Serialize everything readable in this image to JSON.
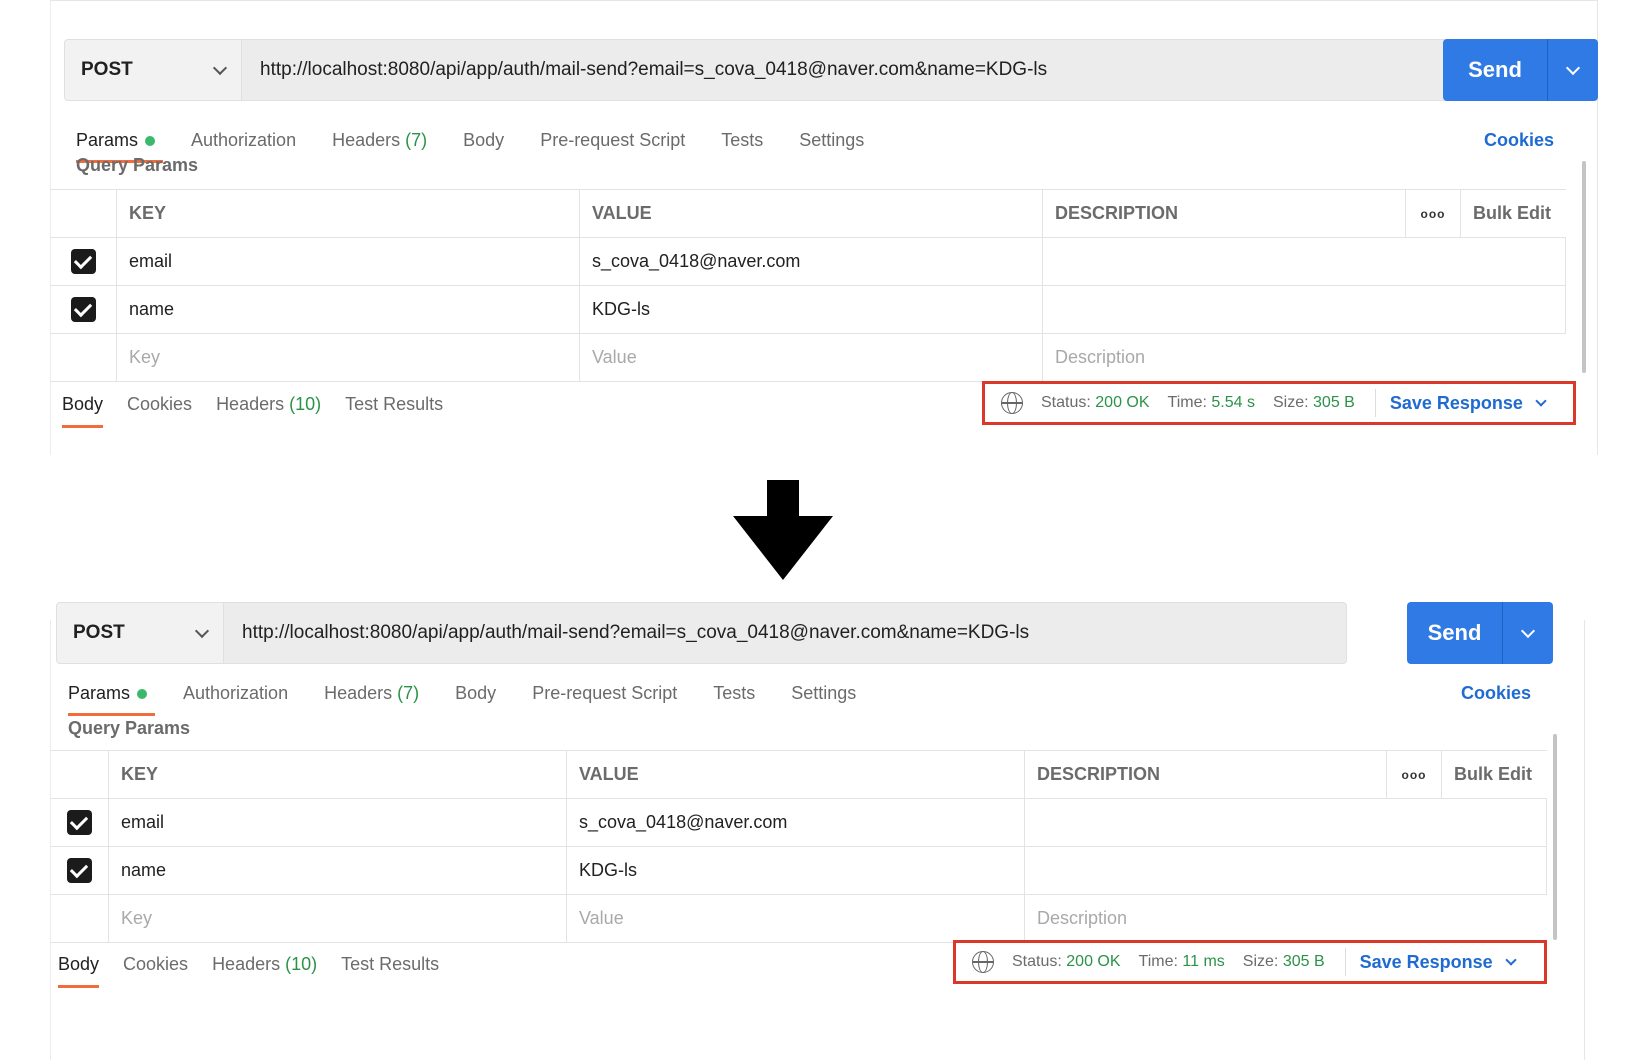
{
  "panels": {
    "top": {
      "method": "POST",
      "url": "http://localhost:8080/api/app/auth/mail-send?email=s_cova_0418@naver.com&name=KDG-ls",
      "send_label": "Send",
      "tabs": [
        "Params",
        "Authorization",
        "Headers",
        "Body",
        "Pre-request Script",
        "Tests",
        "Settings"
      ],
      "headers_count": "(7)",
      "cookies_label": "Cookies",
      "query_params_title": "Query Params",
      "table_headers": {
        "key": "KEY",
        "value": "VALUE",
        "description": "DESCRIPTION",
        "more": "ooo",
        "bulk_edit": "Bulk Edit"
      },
      "rows": [
        {
          "key": "email",
          "value": "s_cova_0418@naver.com"
        },
        {
          "key": "name",
          "value": "KDG-ls"
        }
      ],
      "placeholders": {
        "key": "Key",
        "value": "Value",
        "description": "Description"
      },
      "response_tabs": {
        "body": "Body",
        "cookies": "Cookies",
        "headers": "Headers",
        "headers_count": "(10)",
        "test_results": "Test Results"
      },
      "status": {
        "status_label": "Status:",
        "status_value": "200 OK",
        "time_label": "Time:",
        "time_value": "5.54 s",
        "size_label": "Size:",
        "size_value": "305 B",
        "save_response": "Save Response"
      }
    },
    "bottom": {
      "method": "POST",
      "url": "http://localhost:8080/api/app/auth/mail-send?email=s_cova_0418@naver.com&name=KDG-ls",
      "send_label": "Send",
      "tabs": [
        "Params",
        "Authorization",
        "Headers",
        "Body",
        "Pre-request Script",
        "Tests",
        "Settings"
      ],
      "headers_count": "(7)",
      "cookies_label": "Cookies",
      "query_params_title": "Query Params",
      "table_headers": {
        "key": "KEY",
        "value": "VALUE",
        "description": "DESCRIPTION",
        "more": "ooo",
        "bulk_edit": "Bulk Edit"
      },
      "rows": [
        {
          "key": "email",
          "value": "s_cova_0418@naver.com"
        },
        {
          "key": "name",
          "value": "KDG-ls"
        }
      ],
      "placeholders": {
        "key": "Key",
        "value": "Value",
        "description": "Description"
      },
      "response_tabs": {
        "body": "Body",
        "cookies": "Cookies",
        "headers": "Headers",
        "headers_count": "(10)",
        "test_results": "Test Results"
      },
      "status": {
        "status_label": "Status:",
        "status_value": "200 OK",
        "time_label": "Time:",
        "time_value": "11 ms",
        "size_label": "Size:",
        "size_value": "305 B",
        "save_response": "Save Response"
      }
    }
  },
  "colors": {
    "accent": "#2f7ae5",
    "tab_underline": "#f26b3a",
    "success": "#2b9348",
    "highlight_box": "#d9382b",
    "link": "#1f6bd1"
  },
  "icons": {
    "method_dropdown": "chevron-down-icon",
    "globe": "globe-icon",
    "transition": "arrow-down-icon"
  }
}
